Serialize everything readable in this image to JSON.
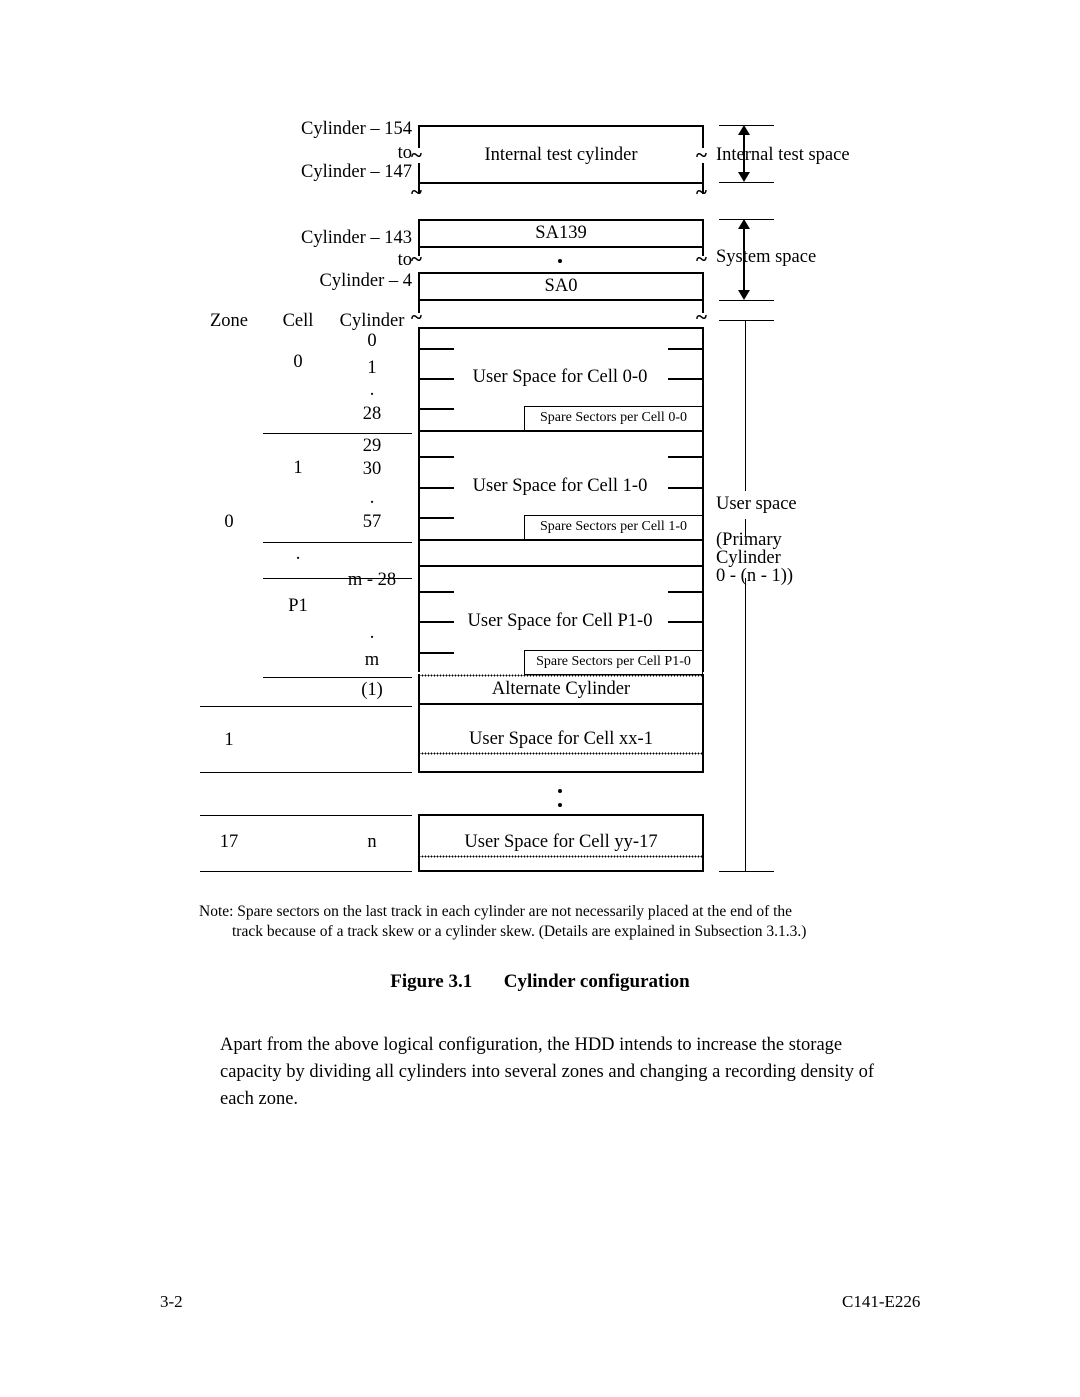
{
  "document": {
    "figure_caption_number": "Figure 3.1",
    "figure_caption_title": "Cylinder configuration",
    "body_paragraph": "Apart from the above logical configuration, the HDD intends to increase the storage capacity by dividing all cylinders into several zones and changing a recording density of each zone.",
    "note_line1": "Note: Spare sectors on the last track in each cylinder are not necessarily placed at the end of the",
    "note_line2": "track because of a track skew or a cylinder skew. (Details are explained in Subsection 3.1.3.)",
    "footer_left": "3-2",
    "footer_right": "C141-E226"
  },
  "diagram": {
    "internal_test": {
      "label_line1": "Cylinder – 154",
      "label_line2": "to",
      "label_line3": "Cylinder – 147",
      "box_label": "Internal test cylinder",
      "space_label": "Internal test space",
      "tilde": "~"
    },
    "system": {
      "label_line1": "Cylinder – 143",
      "label_line2": "to",
      "label_line3": "Cylinder – 4",
      "box_label_top": "SA139",
      "box_label_bottom": "SA0",
      "space_label": "System space",
      "tilde": "~",
      "ellipsis_dot": "•"
    },
    "columns": {
      "zone": "Zone",
      "cell": "Cell",
      "cylinder": "Cylinder"
    },
    "user_space_bracket": {
      "line1": "User space",
      "line2": "(Primary",
      "line3": "Cylinder",
      "line4": "0 - (n - 1))"
    },
    "zone0": {
      "zone_label": "0",
      "cells": [
        {
          "cell_label": "0",
          "cylinders": [
            "0",
            "1",
            ".",
            "28"
          ],
          "user_space_label": "User Space for Cell 0-0",
          "spare_label": "Spare Sectors per Cell 0-0"
        },
        {
          "cell_label": "1",
          "cylinders": [
            "29",
            "30",
            ".",
            "57"
          ],
          "user_space_label": "User Space for Cell 1-0",
          "spare_label": "Spare Sectors per Cell 1-0"
        },
        {
          "cell_label": ".",
          "cylinders": [],
          "user_space_label": "",
          "spare_label": ""
        },
        {
          "cell_label": "P1",
          "cylinders": [
            "m - 28",
            ".",
            "m"
          ],
          "user_space_label": "User Space for Cell P1-0",
          "spare_label": "Spare Sectors per Cell P1-0"
        }
      ],
      "alternate_cylinder_count": "(1)",
      "alternate_cylinder_label": "Alternate Cylinder"
    },
    "zone1": {
      "zone_label": "1",
      "user_space_label": "User Space for Cell xx-1"
    },
    "zone_gap_dots": ".",
    "zone17": {
      "zone_label": "17",
      "cylinder_label": "n",
      "user_space_label": "User Space for Cell yy-17"
    }
  }
}
